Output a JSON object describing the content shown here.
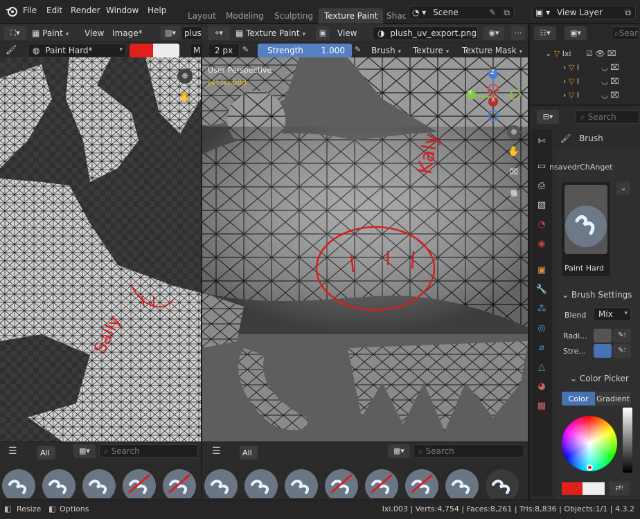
{
  "topbar": {
    "menus": [
      "File",
      "Edit",
      "Render",
      "Window",
      "Help"
    ],
    "workspace_tabs": [
      "Layout",
      "Modeling",
      "Sculpting",
      "Texture Paint",
      "Shac"
    ],
    "active_workspace": "Texture Paint",
    "scene_name": "Scene",
    "view_layer": "View Layer"
  },
  "uv_editor": {
    "mode": "Paint",
    "view_menu": "View",
    "image_menu": "Image*",
    "image_name": "plus",
    "brush_name": "Paint Hard*",
    "color_swatch": "#e0201c",
    "m_label": "M",
    "annotation_text": "Sally",
    "asset_tab": "All",
    "search_placeholder": "Search"
  },
  "viewport": {
    "mode": "Texture Paint",
    "view_menu": "View",
    "image_name": "plush_uv_export.png",
    "radius": "2 px",
    "strength_label": "Strength",
    "strength_value": "1.000",
    "strength_fraction": 1.0,
    "brush_menu": "Brush",
    "texture_menu": "Texture",
    "texture_mask_menu": "Texture Mask",
    "overlay_title": "User Perspective",
    "overlay_object": "(4) Ixi.003",
    "annotation_text": "Kaly",
    "asset_tab": "All",
    "search_placeholder": "Search",
    "gizmo": {
      "x": "X",
      "y": "Y",
      "z": "Z"
    }
  },
  "outliner": {
    "search_placeholder": "Search",
    "collection": "Ixi",
    "items": [
      "I",
      "I",
      "I"
    ]
  },
  "properties": {
    "search_placeholder": "Search",
    "brush_header": "Brush",
    "unsaved_label": "nsavedrChAnget",
    "brush_preview_name": "Paint Hard",
    "brush_settings_header": "Brush Settings",
    "blend_label": "Blend",
    "blend_value": "Mix",
    "radius_label": "Radi...",
    "strength_label": "Stre...",
    "color_picker_header": "Color Picker",
    "color_tab": "Color",
    "gradient_tab": "Gradient",
    "primary_color": "#e0201c",
    "secondary_color": "#f0f0f0"
  },
  "statusbar": {
    "resize": "Resize",
    "options": "Options",
    "stats": "Ixi.003 | Verts:4,754 | Faces:8,261 | Tris:8,836 | Objects:1/1 | 4.3.2"
  },
  "colors": {
    "accent_blue": "#4772b3",
    "paint_red": "#e0201c",
    "active_object_yellow": "#e0c020"
  }
}
